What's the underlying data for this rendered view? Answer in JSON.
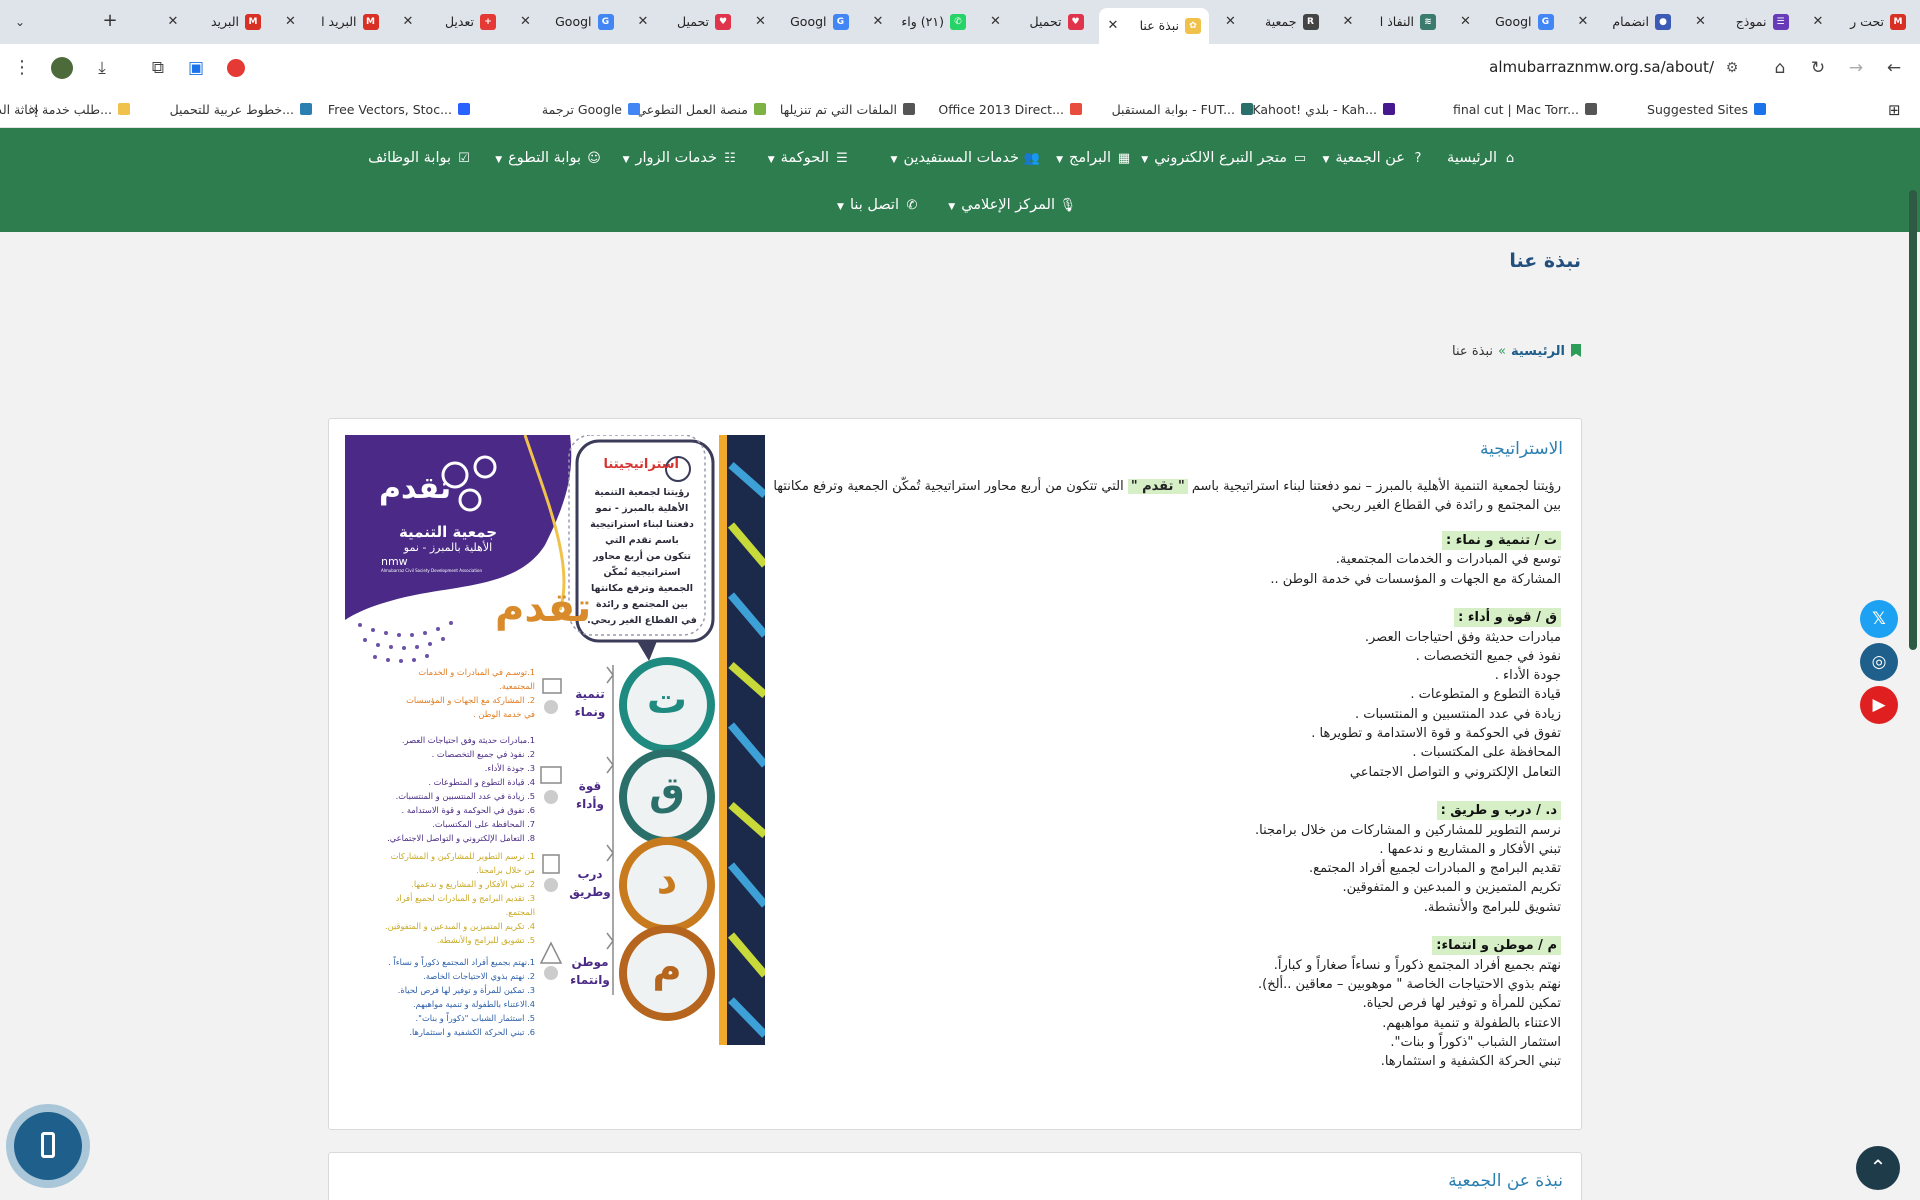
{
  "browser": {
    "tabs": [
      {
        "title": "تحت ر",
        "icon": "gmail-icon",
        "color": "#d93025",
        "letter": "M"
      },
      {
        "title": "نموذج",
        "icon": "forms-icon",
        "color": "#673ab7",
        "letter": "☰"
      },
      {
        "title": "انضمام",
        "icon": "site-icon",
        "color": "#3b5bb5",
        "letter": "●"
      },
      {
        "title": "Googl",
        "icon": "google-icon",
        "color": "#4285f4",
        "letter": "G"
      },
      {
        "title": "النفاذ ا",
        "icon": "site-icon",
        "color": "#3a7b6d",
        "letter": "≋"
      },
      {
        "title": "جمعية",
        "icon": "site-icon",
        "color": "#444444",
        "letter": "R"
      },
      {
        "title": "نبذة عنا",
        "icon": "site-icon",
        "color": "#f0c24b",
        "letter": "✿"
      },
      {
        "title": "تحميل",
        "icon": "heart-icon",
        "color": "#e0334c",
        "letter": "♥"
      },
      {
        "title": "(٢١) واء",
        "icon": "whatsapp-icon",
        "color": "#25d366",
        "letter": "✆"
      },
      {
        "title": "Googl",
        "icon": "google-icon",
        "color": "#4285f4",
        "letter": "G"
      },
      {
        "title": "تحميل",
        "icon": "heart-icon",
        "color": "#e0334c",
        "letter": "♥"
      },
      {
        "title": "Googl",
        "icon": "google-icon",
        "color": "#4285f4",
        "letter": "G"
      },
      {
        "title": "تعديل",
        "icon": "plus-icon",
        "color": "#e53935",
        "letter": "+"
      },
      {
        "title": "البريد ا",
        "icon": "gmail-icon",
        "color": "#d93025",
        "letter": "M"
      },
      {
        "title": "البريد",
        "icon": "gmail-icon",
        "color": "#d93025",
        "letter": "M"
      }
    ],
    "url": "almubarraznmw.org.sa/about/",
    "bookmarks": [
      "Suggested Sites",
      "final cut | Mac Torr...",
      "Kahoot! بلدي - Kah...",
      "بوابة المستقبل - FUT...",
      "Office 2013 Direct...",
      "الملفات التي تم تنزيلها",
      "منصة العمل التطوعي",
      "ترجمة Google",
      "Free Vectors, Stoc...",
      "خطوط عربية للتحميل...",
      "طلب خدمة إغاثة الدع..."
    ],
    "bookmarks_more": "»"
  },
  "nav": {
    "row1": [
      "الرئيسية",
      "عن الجمعية",
      "متجر التبرع الالكتروني",
      "البرامج",
      "خدمات المستفيدين",
      "الحوكمة",
      "خدمات الزوار",
      "بوابة التطوع",
      "بوابة الوظائف"
    ],
    "row2": [
      "المركز الإعلامي",
      "اتصل بنا"
    ]
  },
  "page": {
    "title": "نبذة عنا",
    "breadcrumb": {
      "home": "الرئيسية",
      "sep": "»",
      "current": "نبذة عنا"
    }
  },
  "strategy": {
    "title": "الاستراتيجية",
    "intro_line1_a": "رؤيتنا لجمعية التنمية الأهلية بالمبرز – نمو   دفعتنا لبناء استراتيجية    باسم  ",
    "intro_tag": "\" تقدم \"",
    "intro_line1_b": " التي تتكون من أربع  محاور استراتيجية تُمكّن الجمعية  وترفع مكانتها",
    "intro_line2": "بين المجتمع و رائدة في القطاع الغير ربحي",
    "groups": [
      {
        "head": "ت / تنمية و نماء :",
        "items": [
          "توسع  في المبادرات و الخدمات المجتمعية.",
          "المشاركة مع  الجهات و المؤسسات في خدمة الوطن  .."
        ]
      },
      {
        "head": "ق / قوة  و أداء :",
        "items": [
          "مبادرات حديثة  وفق احتياجات العصر.",
          "نفوذ في جميع التخصصات  .",
          "جودة الأداء .",
          "قيادة التطوع و المتطوعات  .",
          "زيادة في عدد المنتسبين و المنتسبات .",
          "تفوق في الحوكمة و قوة الاستدامة و تطويرها .",
          "المحافظة على المكتسبات .",
          "التعامل الإلكتروني و التواصل الاجتماعي"
        ]
      },
      {
        "head": "د. / درب  و طريق  :",
        "items": [
          "نرسم التطوير للمشاركين و المشاركات من خلال برامجنا.",
          "تبني الأفكار و المشاريع و ندعمها .",
          "تقديم البرامج و المبادرات لجميع أفراد المجتمع.",
          "تكريم المتميزين و المبدعين و المتفوقين.",
          "تشويق للبرامج والأنشطة."
        ]
      },
      {
        "head": "م / موطن و انتماء:",
        "items": [
          "نهتم بجميع أفراد المجتمع ذكوراً و نساءاً  صغاراً و كباراً.",
          "نهتم بذوي الاحتياجات الخاصة \" موهوبين – معاقين ..ألخ).",
          "تمكين للمرأة و توفير لها فرص لحياة.",
          "الاعتناء بالطفولة و تنمية مواهبهم.",
          "استثمار الشباب \"ذكوراً و بنات\".",
          "تبني الحركة الكشفية و استثمارها."
        ]
      }
    ]
  },
  "infographic": {
    "org_name_line1": "جمعية التنمية",
    "org_name_line2": "الأهلية بالمبرز - نمو",
    "org_en": "nmw",
    "org_en_full": "Almubarraz Civil Society Development Association",
    "badge": "استراتيجيتنا",
    "bubble": [
      "رؤيتنا لجمعية التنمية",
      "الأهلية بالمبرز - نمو",
      "دفعتنا لبناء استراتيجية",
      "باسم  تقدم  التي",
      "تتكون من أربع محاور",
      "استراتيجية تُمكّن",
      "الجمعية وترفع مكانتها",
      "بين المجتمع و رائدة",
      "في القطاع الغير ربحي."
    ],
    "brand": "تقدم",
    "pillars": [
      {
        "letter": "ت",
        "l1": "تنمية",
        "l2": "ونماء",
        "color": "#1f8a80"
      },
      {
        "letter": "ق",
        "l1": "قوة",
        "l2": "وأداء",
        "color": "#2b6f6a"
      },
      {
        "letter": "د",
        "l1": "درب",
        "l2": "وطريق",
        "color": "#c87b1e"
      },
      {
        "letter": "م",
        "l1": "موطن",
        "l2": "وانتماء",
        "color": "#b5651d"
      }
    ],
    "list_orange": [
      "1.توسـم في المبادرات و الخدمات",
      "المجتمعية.",
      "2. المشاركة مع الجهات و المؤسسات",
      "في خدمة الوطن ."
    ],
    "list_purple": [
      "1.مبادرات حديثة وفق احتياجات العصر.",
      "2. نفوذ في جميع التخصصات .",
      "3. جودة الأداء.",
      "4. قيادة التطوع و المتطوعات .",
      "5. زيادة في عدد المنتسبين و المنتسبات.",
      "6. تفوق في الحوكمة و قوة الاستدامة .",
      "7. المحافظة على المكتسبات.",
      "8. التعامل الإلكتروني و التواصل الاجتماعي."
    ],
    "list_yellow": [
      "1. نرسم التطوير للمشاركين و المشاركات",
      "من خلال برامجنا.",
      "2. تبني الأفكار و المشاريع و ندعمها.",
      "3. تقديم البرامج و المبادرات لجميع أفراد",
      "المجتمع.",
      "4. تكريم المتميزين و المبدعين و المتفوقين.",
      "5. تشويق للبرامج والأنشطة."
    ],
    "list_blue": [
      "1.نهتم بجميع أفراد المجتمع ذكوراً و نساءاً .",
      "2. نهتم بذوي الاحتياجات الخاصة.",
      "3. تمكين للمرأة و توفير لها فرص لحياة.",
      "4.الاعتناء بالطفولة و تنمية مواهبهم.",
      "5. استثمار الشباب \"ذكوراً و بنات\".",
      "6. تبني الحركة الكشفية و استثمارها."
    ]
  },
  "about_section_title": "نبذة عن الجمعية",
  "social": {
    "x": "𝕏",
    "instagram": "◎",
    "youtube": "▶"
  },
  "scroll_top": "⌃"
}
